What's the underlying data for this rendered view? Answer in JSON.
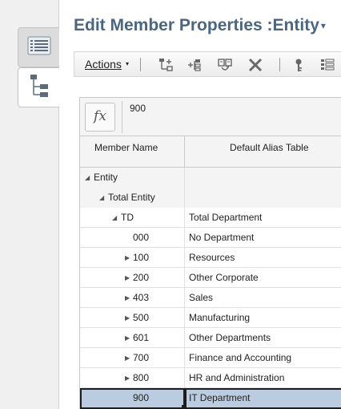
{
  "window": {
    "title": "Edit Member Properties :Entity",
    "title_caret": "▾"
  },
  "side_tabs": [
    {
      "name": "properties-tab",
      "icon": "list-icon",
      "active": false
    },
    {
      "name": "hierarchy-tab",
      "icon": "hierarchy-tree-icon",
      "active": true
    }
  ],
  "toolbar": {
    "actions_label": "Actions",
    "actions_caret": "▾",
    "icons": [
      "add-child-icon",
      "add-sibling-icon",
      "move-member-icon",
      "delete-icon",
      "key-icon",
      "properties-grid-icon"
    ]
  },
  "formula_bar": {
    "fx_label": "fx",
    "value": "900"
  },
  "grid": {
    "columns": [
      "Member Name",
      "Default Alias Table"
    ],
    "rows": [
      {
        "name": "Entity",
        "alias": "",
        "expander": "◢",
        "level": 0,
        "style": "gray"
      },
      {
        "name": "Total Entity",
        "alias": "",
        "expander": "◢",
        "level": 1,
        "style": "gray"
      },
      {
        "name": "TD",
        "alias": "Total Department",
        "expander": "◢",
        "level": 2,
        "style": ""
      },
      {
        "name": "000",
        "alias": "No Department",
        "expander": "",
        "level": 3,
        "style": ""
      },
      {
        "name": "100",
        "alias": "Resources",
        "expander": "▶",
        "level": 3,
        "style": ""
      },
      {
        "name": "200",
        "alias": "Other Corporate",
        "expander": "▶",
        "level": 3,
        "style": ""
      },
      {
        "name": "403",
        "alias": "Sales",
        "expander": "▶",
        "level": 3,
        "style": ""
      },
      {
        "name": "500",
        "alias": "Manufacturing",
        "expander": "▶",
        "level": 3,
        "style": ""
      },
      {
        "name": "601",
        "alias": "Other Departments",
        "expander": "▶",
        "level": 3,
        "style": ""
      },
      {
        "name": "700",
        "alias": "Finance and Accounting",
        "expander": "▶",
        "level": 3,
        "style": ""
      },
      {
        "name": "800",
        "alias": "HR and Administration",
        "expander": "▶",
        "level": 3,
        "style": ""
      },
      {
        "name": "900",
        "alias": "IT Department",
        "expander": "",
        "level": 3,
        "style": "selected"
      }
    ]
  },
  "colors": {
    "title": "#4a6681",
    "selected_row": "#bccce0",
    "header_bg": "#f4f4f4"
  }
}
